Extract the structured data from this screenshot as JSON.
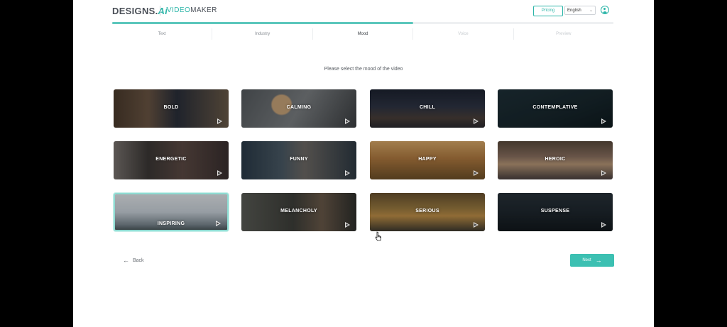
{
  "header": {
    "logo_main": "DESIGNS.",
    "logo_ai": "Ai",
    "product_prefix": "VIDEO",
    "product_suffix": "MAKER",
    "pricing_label": "Pricing",
    "language_value": "English"
  },
  "steps": [
    {
      "label": "Text",
      "state": "done"
    },
    {
      "label": "Industry",
      "state": "done"
    },
    {
      "label": "Mood",
      "state": "active"
    },
    {
      "label": "Voice",
      "state": "future"
    },
    {
      "label": "Preview",
      "state": "future"
    }
  ],
  "progress_fraction": 0.6,
  "prompt": "Please select the mood of the video",
  "moods": [
    {
      "label": "BOLD"
    },
    {
      "label": "CALMING"
    },
    {
      "label": "CHILL"
    },
    {
      "label": "CONTEMPLATIVE"
    },
    {
      "label": "ENERGETIC"
    },
    {
      "label": "FUNNY"
    },
    {
      "label": "HAPPY"
    },
    {
      "label": "HEROIC"
    },
    {
      "label": "INSPIRING",
      "selected": true
    },
    {
      "label": "MELANCHOLY"
    },
    {
      "label": "SERIOUS"
    },
    {
      "label": "SUSPENSE"
    }
  ],
  "nav": {
    "back_label": "Back",
    "next_label": "Next"
  },
  "colors": {
    "accent": "#2cb5a8",
    "next_button": "#3cc0b2"
  }
}
